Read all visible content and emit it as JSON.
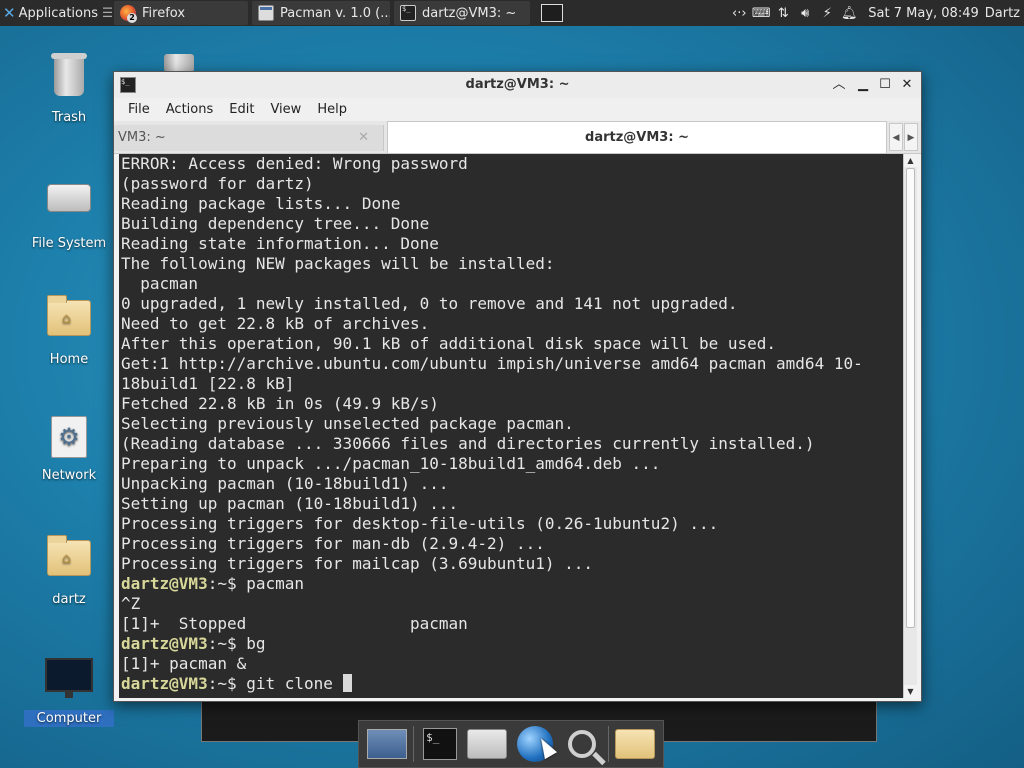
{
  "top_panel": {
    "apps_label": "Applications",
    "tasks": [
      {
        "label": "Firefox",
        "icon": "firefox-icon",
        "badge": "2"
      },
      {
        "label": "Pacman v. 1.0 (...",
        "icon": "window-icon"
      },
      {
        "label": "dartz@VM3: ~",
        "icon": "terminal-icon"
      }
    ],
    "tray_icons": [
      "network-icon",
      "keyboard-icon",
      "transfer-icon",
      "volume-icon",
      "power-icon",
      "notifications-icon"
    ],
    "clock": "Sat  7 May, 08:49",
    "user": "Dartz"
  },
  "desktop_icons": [
    {
      "label": "Trash",
      "icon": "trash-icon"
    },
    {
      "label": "File System",
      "icon": "drive-icon"
    },
    {
      "label": "Home",
      "icon": "home-folder-icon"
    },
    {
      "label": "Network",
      "icon": "network-settings-icon"
    },
    {
      "label": "dartz",
      "icon": "home-folder-icon"
    },
    {
      "label": "Computer",
      "icon": "computer-icon"
    }
  ],
  "window": {
    "title": "dartz@VM3: ~",
    "menu": [
      "File",
      "Actions",
      "Edit",
      "View",
      "Help"
    ],
    "tabs": {
      "inactive": "VM3: ~",
      "active": "dartz@VM3: ~"
    }
  },
  "terminal": {
    "prompt": "dartz@VM3",
    "prompt_suffix": ":~$ ",
    "lines": [
      {
        "text": "ERROR: Access denied: Wrong password"
      },
      {
        "text": "(password for dartz)"
      },
      {
        "text": "Reading package lists... Done"
      },
      {
        "text": "Building dependency tree... Done"
      },
      {
        "text": "Reading state information... Done"
      },
      {
        "text": "The following NEW packages will be installed:"
      },
      {
        "text": "  pacman"
      },
      {
        "text": "0 upgraded, 1 newly installed, 0 to remove and 141 not upgraded."
      },
      {
        "text": "Need to get 22.8 kB of archives."
      },
      {
        "text": "After this operation, 90.1 kB of additional disk space will be used."
      },
      {
        "text": "Get:1 http://archive.ubuntu.com/ubuntu impish/universe amd64 pacman amd64 10-18build1 [22.8 kB]"
      },
      {
        "text": "Fetched 22.8 kB in 0s (49.9 kB/s)"
      },
      {
        "text": "Selecting previously unselected package pacman."
      },
      {
        "text": "(Reading database ... 330666 files and directories currently installed.)"
      },
      {
        "text": "Preparing to unpack .../pacman_10-18build1_amd64.deb ..."
      },
      {
        "text": "Unpacking pacman (10-18build1) ..."
      },
      {
        "text": "Setting up pacman (10-18build1) ..."
      },
      {
        "text": "Processing triggers for desktop-file-utils (0.26-1ubuntu2) ..."
      },
      {
        "text": "Processing triggers for man-db (2.9.4-2) ..."
      },
      {
        "text": "Processing triggers for mailcap (3.69ubuntu1) ..."
      },
      {
        "prompt": true,
        "text": "pacman"
      },
      {
        "text": "^Z"
      },
      {
        "text": "[1]+  Stopped                 pacman"
      },
      {
        "prompt": true,
        "text": "bg"
      },
      {
        "text": "[1]+ pacman &"
      },
      {
        "prompt": true,
        "text": "git clone ",
        "cursor": true
      }
    ]
  },
  "dock_items": [
    {
      "name": "show-desktop-icon"
    },
    {
      "name": "terminal-icon"
    },
    {
      "name": "file-manager-icon"
    },
    {
      "name": "web-browser-icon"
    },
    {
      "name": "app-finder-icon"
    },
    {
      "name": "folder-icon"
    }
  ],
  "colors": {
    "terminal_bg": "#2b2b2b",
    "terminal_fg": "#e6e6e6",
    "prompt": "#d7d79a",
    "desktop": "#1d7fab"
  }
}
